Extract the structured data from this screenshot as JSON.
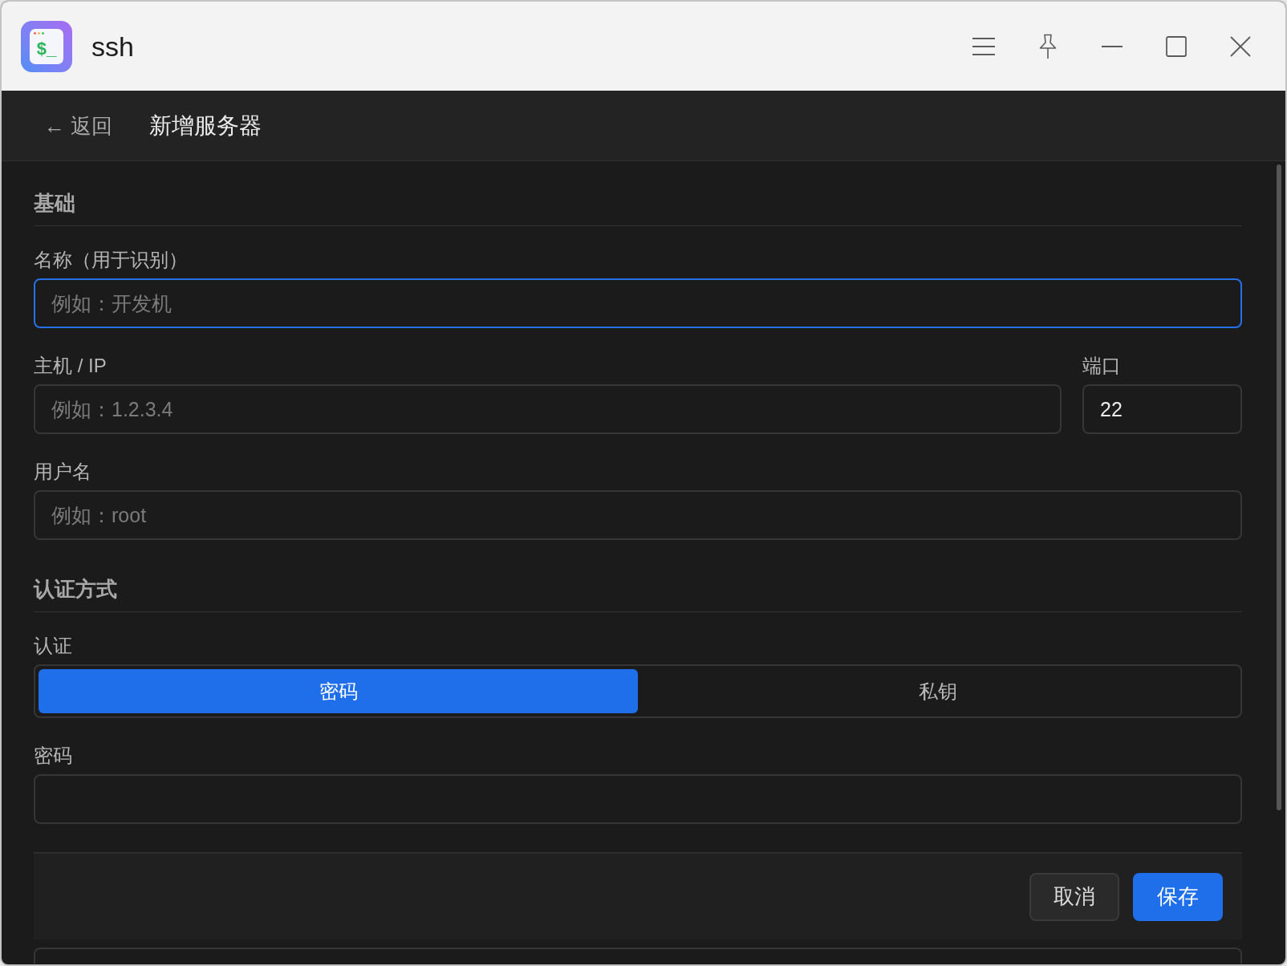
{
  "window": {
    "title": "ssh",
    "icon_text": "$_"
  },
  "header": {
    "back_link": "← 返回",
    "title": "新增服务器"
  },
  "sections": [
    {
      "title": "基础",
      "rows": [
        [
          {
            "kind": "text",
            "label": "名称（用于识别）",
            "placeholder": "例如：开发机",
            "focused": true
          }
        ],
        [
          {
            "kind": "text",
            "label": "主机 / IP",
            "placeholder": "例如：1.2.3.4",
            "focused": false
          },
          {
            "kind": "number",
            "label": "端口",
            "value": "22",
            "focused": false
          }
        ],
        [
          {
            "kind": "text",
            "label": "用户名",
            "placeholder": "例如：root",
            "focused": false
          }
        ]
      ]
    },
    {
      "title": "认证方式",
      "rows": [
        [
          {
            "kind": "segmented",
            "label": "认证",
            "options": [
              {
                "label": "密码",
                "selected": true
              },
              {
                "label": "私钥",
                "selected": false
              }
            ]
          }
        ],
        [
          {
            "kind": "password",
            "label": "密码",
            "focused": false
          }
        ]
      ]
    }
  ],
  "actions": [
    {
      "kind": "secondary",
      "label": "取消"
    },
    {
      "kind": "primary",
      "label": "保存"
    }
  ],
  "below_actions": [
    {
      "kind": "field"
    }
  ]
}
